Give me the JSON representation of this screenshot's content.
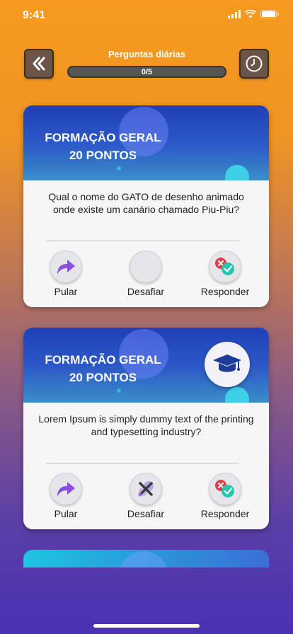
{
  "status": {
    "time": "9:41"
  },
  "header": {
    "title": "Perguntas diárias",
    "progress_text": "0/5",
    "progress_value": 0
  },
  "cards": [
    {
      "category": "FORMAÇÃO GERAL",
      "points": "20 PONTOS",
      "question": "Qual o nome do GATO de desenho animado onde existe um canário chamado Piu-Piu?",
      "actions": {
        "skip": "Pular",
        "challenge": "Desafiar",
        "answer": "Responder"
      }
    },
    {
      "category": "FORMAÇÃO GERAL",
      "points": "20 PONTOS",
      "question": "Lorem Ipsum is simply dummy text of the printing and typesetting industry?",
      "actions": {
        "skip": "Pular",
        "challenge": "Desafiar",
        "answer": "Responder"
      }
    }
  ],
  "icons": {
    "back": "double-chevron-left-icon",
    "clock": "clock-icon",
    "skip": "curved-arrow-right-icon",
    "challenge": "crossed-swords-icon",
    "answer": "wrong-right-icon",
    "badge": "graduation-cap-icon"
  },
  "colors": {
    "accent_orange": "#f79a1e",
    "accent_purple": "#4a31b3",
    "banner_blue": "#1f3fb8",
    "skip_purple": "#8a4fe0",
    "answer_red": "#e23b48",
    "answer_teal": "#27c6b0"
  }
}
